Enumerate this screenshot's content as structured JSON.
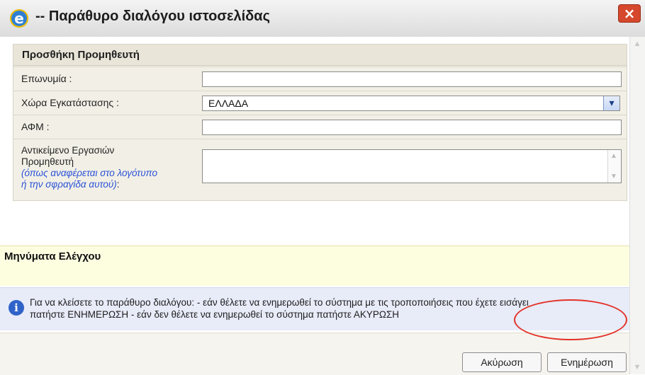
{
  "window": {
    "title": "-- Παράθυρο διαλόγου ιστοσελίδας",
    "close_label": "×"
  },
  "form": {
    "header": "Προσθήκη Προμηθευτή",
    "fields": [
      {
        "label": "Επωνυμία :",
        "value": ""
      },
      {
        "label": "Χώρα Εγκατάστασης :",
        "value": "ΕΛΛΑΔΑ"
      },
      {
        "label": "ΑΦΜ :",
        "value": ""
      }
    ],
    "description": {
      "label_line1": "Αντικείμενο Εργασιών",
      "label_line2": "Προμηθευτή",
      "hint_line1": "(όπως αναφέρεται στο λογότυπο",
      "hint_line2": "ή την σφραγίδα αυτού)",
      "hint_suffix": ":",
      "value": ""
    }
  },
  "messages": {
    "title": "Μηνύματα Ελέγχου"
  },
  "info": {
    "line1": "Για να κλείσετε το παράθυρο διαλόγου: - εάν θέλετε να ενημερωθεί το σύστημα με τις τροποποιήσεις που έχετε εισάγει",
    "line2": "πατήστε ΕΝΗΜΕΡΩΣΗ - εάν δεν θέλετε να ενημερωθεί το σύστημα πατήστε ΑΚΥΡΩΣΗ"
  },
  "buttons": {
    "cancel": "Ακύρωση",
    "update": "Ενημέρωση"
  },
  "icons": {
    "app": "internet-explorer-icon",
    "close": "close-icon",
    "select": "chevron-down-icon",
    "info": "info-icon"
  },
  "colors": {
    "close_button": "#d5482d",
    "highlight": "#e33127",
    "hint_text": "#2b52d8"
  }
}
